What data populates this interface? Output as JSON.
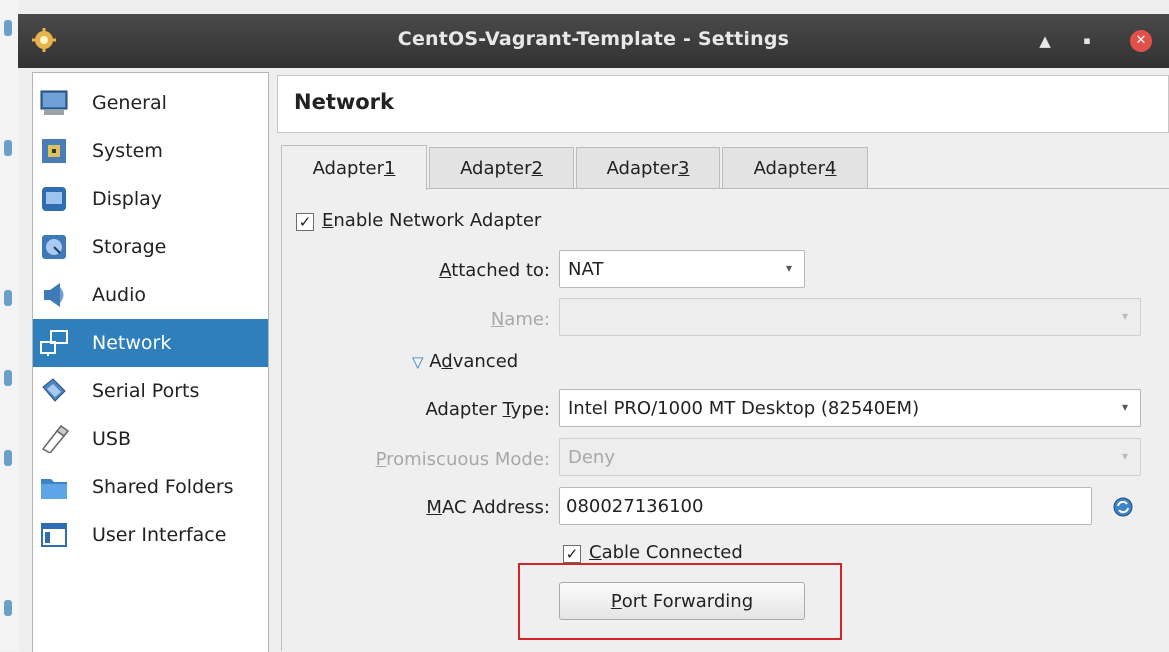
{
  "window": {
    "title": "CentOS-Vagrant-Template - Settings"
  },
  "sidebar": {
    "items": [
      {
        "label": "General"
      },
      {
        "label": "System"
      },
      {
        "label": "Display"
      },
      {
        "label": "Storage"
      },
      {
        "label": "Audio"
      },
      {
        "label": "Network"
      },
      {
        "label": "Serial Ports"
      },
      {
        "label": "USB"
      },
      {
        "label": "Shared Folders"
      },
      {
        "label": "User Interface"
      }
    ],
    "selected": "Network"
  },
  "main": {
    "heading": "Network",
    "tabs": [
      {
        "pre": "Adapter ",
        "key": "1"
      },
      {
        "pre": "Adapter ",
        "key": "2"
      },
      {
        "pre": "Adapter ",
        "key": "3"
      },
      {
        "pre": "Adapter ",
        "key": "4"
      }
    ],
    "enable_adapter": {
      "pre": "",
      "key": "E",
      "post": "nable Network Adapter",
      "checked": true
    },
    "attached_to": {
      "pre": "",
      "key": "A",
      "post": "ttached to:",
      "value": "NAT"
    },
    "name": {
      "pre": "",
      "key": "N",
      "post": "ame:",
      "value": ""
    },
    "advanced": {
      "pre": "A",
      "key": "d",
      "post": "vanced",
      "expanded": true
    },
    "adapter_type": {
      "pre": "Adapter ",
      "key": "T",
      "post": "ype:",
      "value": "Intel PRO/1000 MT Desktop (82540EM)"
    },
    "promiscuous": {
      "pre": "",
      "key": "P",
      "post": "romiscuous Mode:",
      "value": "Deny"
    },
    "mac": {
      "pre": "",
      "key": "M",
      "post": "AC Address:",
      "value": "080027136100"
    },
    "cable_connected": {
      "pre": "",
      "key": "C",
      "post": "able Connected",
      "checked": true
    },
    "port_forwarding": {
      "pre": "",
      "key": "P",
      "post": "ort Forwarding"
    }
  },
  "colors": {
    "selection": "#2f7fbd",
    "highlight": "#d0262b"
  }
}
